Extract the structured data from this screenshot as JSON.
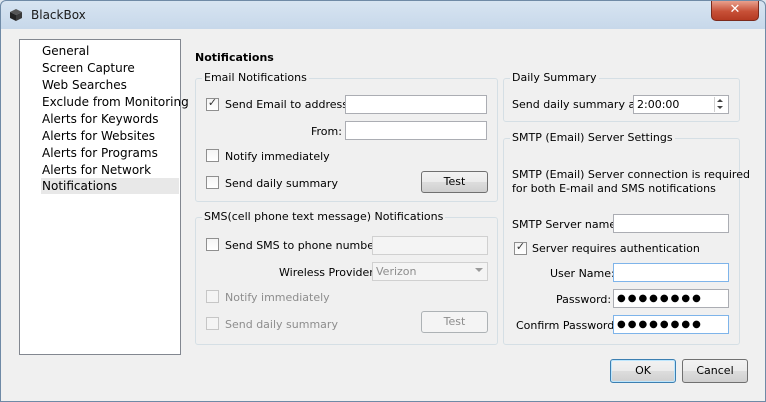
{
  "window": {
    "title": "BlackBox",
    "close_glyph": "✕"
  },
  "nav": {
    "items": [
      "General",
      "Screen Capture",
      "Web Searches",
      "Exclude from Monitoring",
      "Alerts for Keywords",
      "Alerts for Websites",
      "Alerts for Programs",
      "Alerts for Network",
      "Notifications"
    ],
    "selected": "Notifications"
  },
  "page": {
    "heading": "Notifications"
  },
  "email": {
    "group_title": "Email Notifications",
    "send_email_label": "Send Email to address:",
    "send_email_checked": true,
    "to_value": "",
    "from_label": "From:",
    "from_value": "",
    "notify_immediately_label": "Notify immediately",
    "notify_immediately_checked": false,
    "daily_summary_label": "Send daily summary",
    "daily_summary_checked": false,
    "test_label": "Test"
  },
  "sms": {
    "group_title": "SMS(cell phone text message) Notifications",
    "send_sms_label": "Send SMS to phone number:",
    "send_sms_checked": false,
    "phone_value": "",
    "provider_label": "Wireless Provider:",
    "provider_value": "Verizon",
    "notify_immediately_label": "Notify immediately",
    "daily_summary_label": "Send daily summary",
    "test_label": "Test"
  },
  "daily_summary": {
    "group_title": "Daily Summary",
    "label": "Send daily summary at:",
    "time_value": "2:00:00"
  },
  "smtp": {
    "group_title": "SMTP (Email) Server Settings",
    "note_line1": "SMTP (Email) Server connection is required",
    "note_line2": "for both E-mail and SMS notifications",
    "server_name_label": "SMTP Server name:",
    "server_name_value": "",
    "requires_auth_label": "Server requires authentication",
    "requires_auth_checked": true,
    "username_label": "User Name:",
    "username_value": "",
    "password_label": "Password:",
    "password_value": "●●●●●●●●",
    "confirm_label": "Confirm Password:",
    "confirm_value": "●●●●●●●●"
  },
  "footer": {
    "ok_label": "OK",
    "cancel_label": "Cancel"
  },
  "icons": {
    "check": "✓",
    "app": "cube-icon"
  }
}
